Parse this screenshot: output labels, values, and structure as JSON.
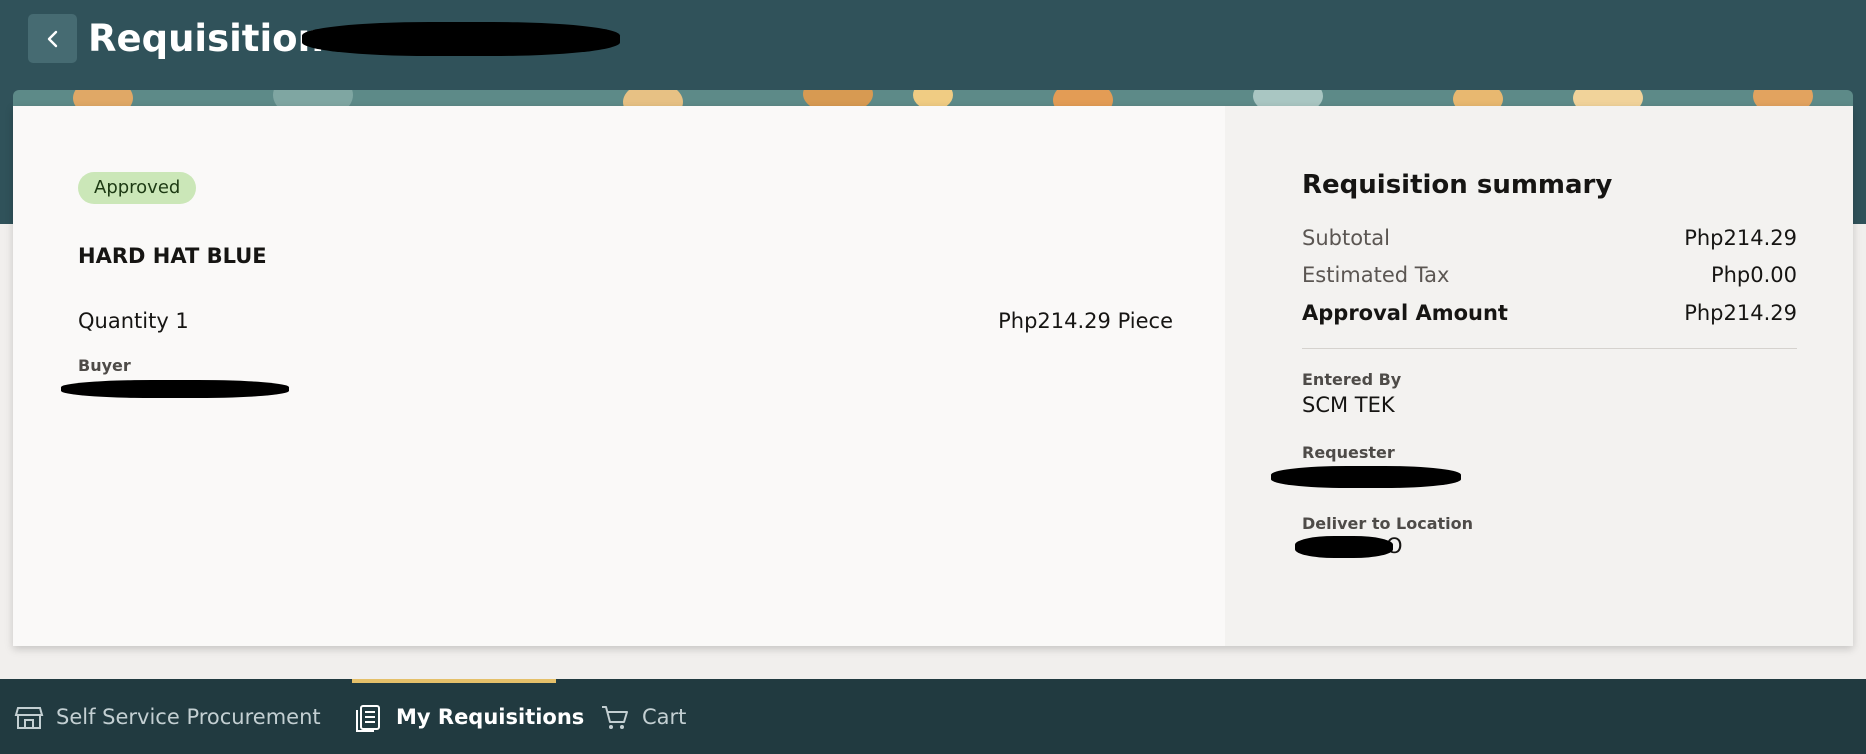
{
  "header": {
    "title": "Requisition",
    "back_icon": "chevron-left-icon"
  },
  "status": {
    "label": "Approved",
    "color": "#cbe7b8"
  },
  "line_item": {
    "name": "HARD HAT BLUE",
    "quantity_text": "Quantity 1",
    "price_text": "Php214.29 Piece",
    "buyer_label": "Buyer"
  },
  "summary": {
    "title": "Requisition summary",
    "rows": [
      {
        "label": "Subtotal",
        "value": "Php214.29"
      },
      {
        "label": "Estimated Tax",
        "value": "Php0.00"
      },
      {
        "label": "Approval Amount",
        "value": "Php214.29"
      }
    ],
    "entered_by_label": "Entered By",
    "entered_by_value": "SCM TEK",
    "requester_label": "Requester",
    "deliver_label": "Deliver to Location",
    "deliver_value_visible": "O"
  },
  "bottom_nav": {
    "items": [
      {
        "label": "Self Service Procurement",
        "icon": "store-icon",
        "active": false
      },
      {
        "label": "My Requisitions",
        "icon": "clipboard-list-icon",
        "active": true
      },
      {
        "label": "Cart",
        "icon": "cart-icon",
        "active": false
      }
    ],
    "active_indicator_color": "#e5c06a"
  },
  "colors": {
    "header": "#30525a",
    "bottom_nav": "#213a40"
  }
}
